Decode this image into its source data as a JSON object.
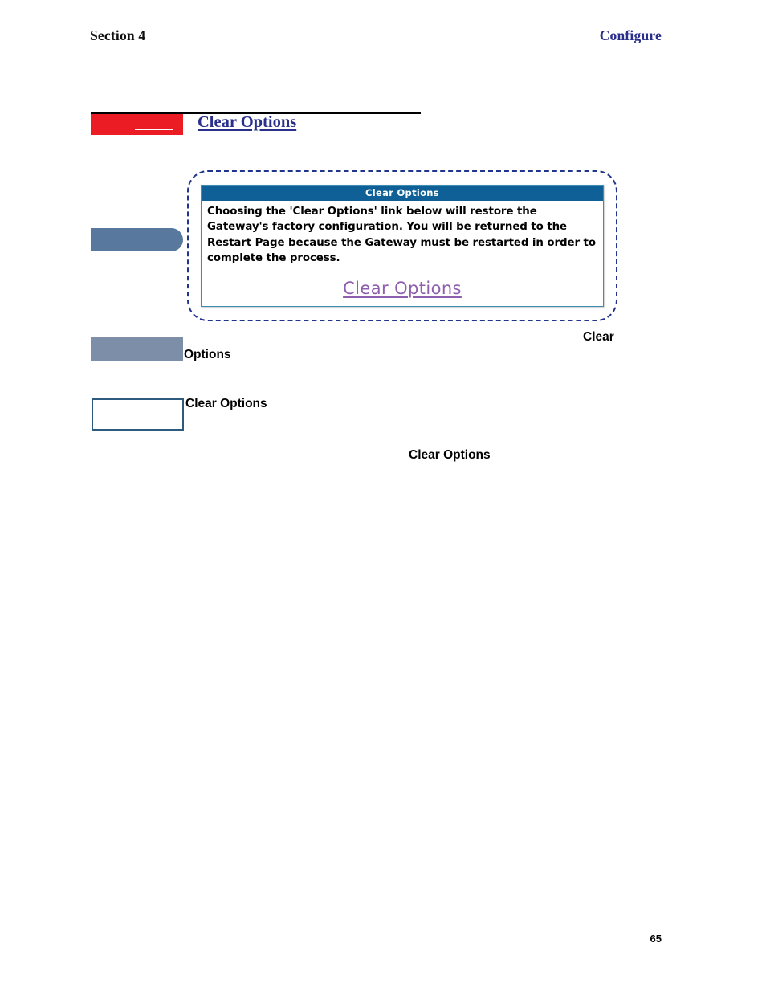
{
  "header": {
    "section": "Section 4",
    "chapter": "Configure"
  },
  "section": {
    "title": "Clear Options"
  },
  "screenshot": {
    "titlebar": "Clear Options",
    "body": "Choosing the 'Clear Options' link below will restore the Gateway's factory configuration. You will be returned to the Restart Page because the Gateway must be restarted in order to complete the process.",
    "link": "Clear Options"
  },
  "body_fragments": {
    "clear_tail": "Clear",
    "options_head": "Options",
    "outline_text": "Clear Options",
    "indented": "Clear Options"
  },
  "colors": {
    "accent_red": "#ec1c24",
    "heading_blue": "#2b2f8c",
    "titlebar_blue": "#0e6096",
    "link_purple": "#8e5fae",
    "pill_slate": "#59789e",
    "bar_slate": "#7d8ea8",
    "outline_slate": "#2e5a7d",
    "callout_dash": "#21358c"
  },
  "footer": {
    "page_number": "65"
  }
}
